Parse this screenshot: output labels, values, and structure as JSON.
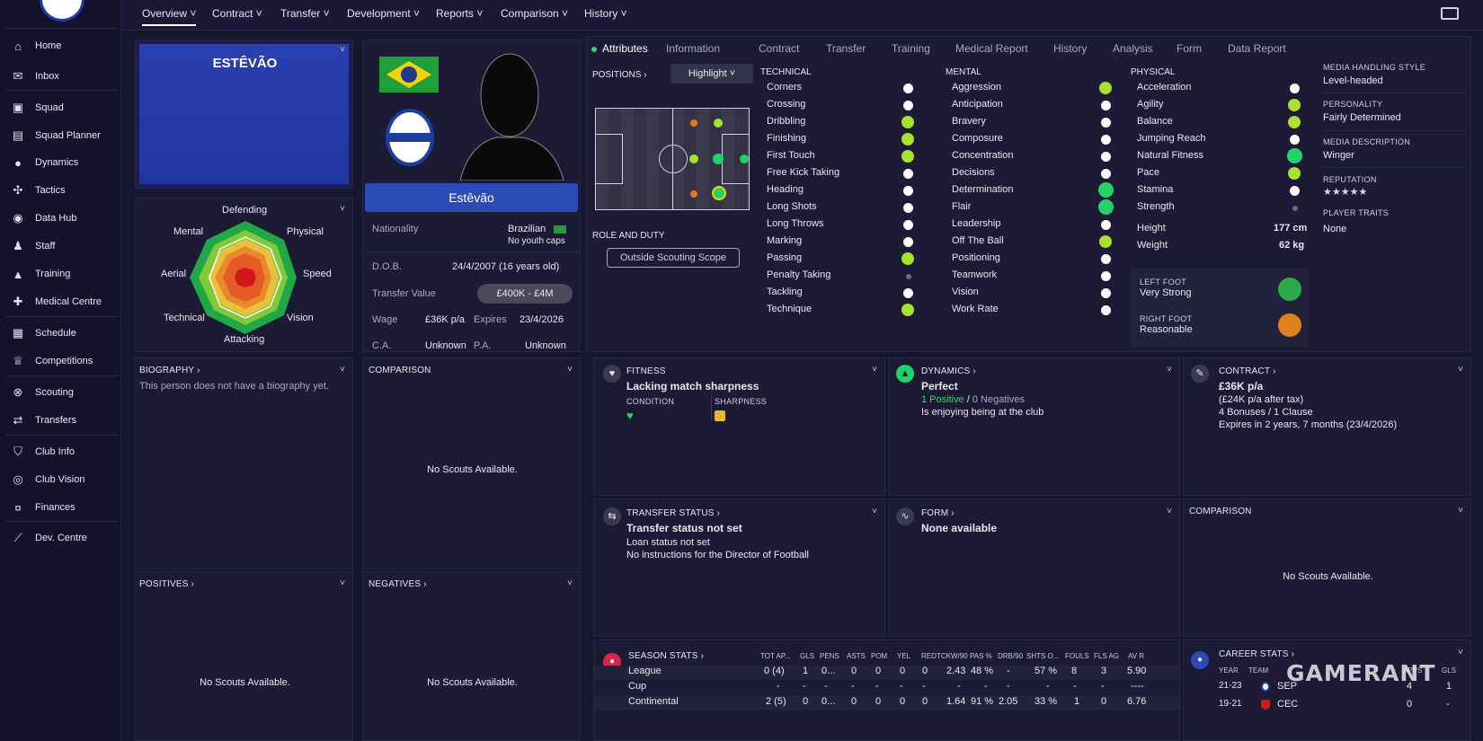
{
  "nav": {
    "tabs": [
      "Overview",
      "Contract",
      "Transfer",
      "Development",
      "Reports",
      "Comparison",
      "History"
    ]
  },
  "sidebar": {
    "items": [
      "Home",
      "Inbox",
      "Squad",
      "Squad Planner",
      "Dynamics",
      "Tactics",
      "Data Hub",
      "Staff",
      "Training",
      "Medical Centre",
      "Schedule",
      "Competitions",
      "Scouting",
      "Transfers",
      "Club Info",
      "Club Vision",
      "Finances",
      "Dev. Centre"
    ]
  },
  "player": {
    "name_banner": "ESTÊVÃO",
    "name": "Estêvão",
    "nationality_label": "Nationality",
    "nationality": "Brazilian",
    "caps": "No youth caps",
    "dob_label": "D.O.B.",
    "dob": "24/4/2007 (16 years old)",
    "tv_label": "Transfer Value",
    "tv": "£400K - £4M",
    "wage_label": "Wage",
    "wage": "£36K p/a",
    "expires_label": "Expires",
    "expires": "23/4/2026",
    "ca_label": "C.A.",
    "ca": "Unknown",
    "pa_label": "P.A.",
    "pa": "Unknown"
  },
  "radar": {
    "labels": [
      "Defending",
      "Physical",
      "Speed",
      "Vision",
      "Attacking",
      "Technical",
      "Aerial",
      "Mental"
    ]
  },
  "attr_tabs": [
    "Attributes",
    "Information",
    "Contract",
    "Transfer",
    "Training",
    "Medical Report",
    "History",
    "Analysis",
    "Form",
    "Data Report"
  ],
  "positions_label": "POSITIONS",
  "highlight": "Highlight",
  "role_label": "ROLE AND DUTY",
  "role_btn": "Outside Scouting Scope",
  "technical": {
    "title": "TECHNICAL",
    "items": [
      "Corners",
      "Crossing",
      "Dribbling",
      "Finishing",
      "First Touch",
      "Free Kick Taking",
      "Heading",
      "Long Shots",
      "Long Throws",
      "Marking",
      "Passing",
      "Penalty Taking",
      "Tackling",
      "Technique"
    ]
  },
  "mental": {
    "title": "MENTAL",
    "items": [
      "Aggression",
      "Anticipation",
      "Bravery",
      "Composure",
      "Concentration",
      "Decisions",
      "Determination",
      "Flair",
      "Leadership",
      "Off The Ball",
      "Positioning",
      "Teamwork",
      "Vision",
      "Work Rate"
    ]
  },
  "physical": {
    "title": "PHYSICAL",
    "items": [
      "Acceleration",
      "Agility",
      "Balance",
      "Jumping Reach",
      "Natural Fitness",
      "Pace",
      "Stamina",
      "Strength"
    ],
    "height_label": "Height",
    "height": "177 cm",
    "weight_label": "Weight",
    "weight": "62 kg"
  },
  "feet": {
    "left_label": "LEFT FOOT",
    "left": "Very Strong",
    "right_label": "RIGHT FOOT",
    "right": "Reasonable"
  },
  "media": {
    "mhs_label": "MEDIA HANDLING STYLE",
    "mhs": "Level-headed",
    "pers_label": "PERSONALITY",
    "pers": "Fairly Determined",
    "desc_label": "MEDIA DESCRIPTION",
    "desc": "Winger",
    "rep_label": "REPUTATION",
    "rep_stars": "★★★★★",
    "traits_label": "PLAYER TRAITS",
    "traits": "None"
  },
  "bio": {
    "title": "BIOGRAPHY",
    "text": "This person does not have a biography yet."
  },
  "comparison": {
    "title": "COMPARISON",
    "text": "No Scouts Available."
  },
  "positives": {
    "title": "POSITIVES",
    "text": "No Scouts Available."
  },
  "negatives": {
    "title": "NEGATIVES",
    "text": "No Scouts Available."
  },
  "fitness": {
    "title": "FITNESS",
    "status": "Lacking match sharpness",
    "cond_label": "CONDITION",
    "sharp_label": "SHARPNESS"
  },
  "dynamics": {
    "title": "DYNAMICS",
    "status": "Perfect",
    "pos": "1 Positive",
    "neg": "0 Negatives",
    "text": "Is enjoying being at the club"
  },
  "contract": {
    "title": "CONTRACT",
    "wage": "£36K p/a",
    "after_tax": "(£24K p/a after tax)",
    "bonuses": "4 Bonuses / 1 Clause",
    "expires": "Expires in 2 years, 7 months (23/4/2026)"
  },
  "transfer_status": {
    "title": "TRANSFER STATUS",
    "status": "Transfer status not set",
    "loan": "Loan status not set",
    "dof": "No instructions for the Director of Football"
  },
  "form": {
    "title": "FORM",
    "status": "None available"
  },
  "comparison2": {
    "title": "COMPARISON",
    "text": "No Scouts Available."
  },
  "season": {
    "title": "SEASON STATS",
    "headers": [
      "TOT AP...",
      "GLS",
      "PENS",
      "ASTS",
      "POM",
      "YEL",
      "RED",
      "TCKW/90",
      "PAS %",
      "DRB/90",
      "SHTS O...",
      "FOULS",
      "FLS AG",
      "AV R"
    ],
    "rows": [
      {
        "name": "League",
        "vals": [
          "0 (4)",
          "1",
          "0...",
          "0",
          "0",
          "0",
          "0",
          "2.43",
          "48 %",
          "-",
          "57 %",
          "8",
          "3",
          "5.90"
        ]
      },
      {
        "name": "Cup",
        "vals": [
          "-",
          "-",
          "-",
          "-",
          "-",
          "-",
          "-",
          "-",
          "-",
          "-",
          "-",
          "-",
          "-",
          "----"
        ]
      },
      {
        "name": "Continental",
        "vals": [
          "2 (5)",
          "0",
          "0...",
          "0",
          "0",
          "0",
          "0",
          "1.64",
          "91 %",
          "2.05",
          "33 %",
          "1",
          "0",
          "6.76"
        ]
      }
    ]
  },
  "career": {
    "title": "CAREER STATS",
    "year_label": "YEAR",
    "team_label": "TEAM",
    "apps_label": "APPS",
    "gls_label": "GLS",
    "rows": [
      {
        "year": "21-23",
        "team": "SEP",
        "apps": "4",
        "gls": "1"
      },
      {
        "year": "19-21",
        "team": "CEC",
        "apps": "0",
        "gls": "-"
      }
    ]
  },
  "watermark": "GAMERANT"
}
